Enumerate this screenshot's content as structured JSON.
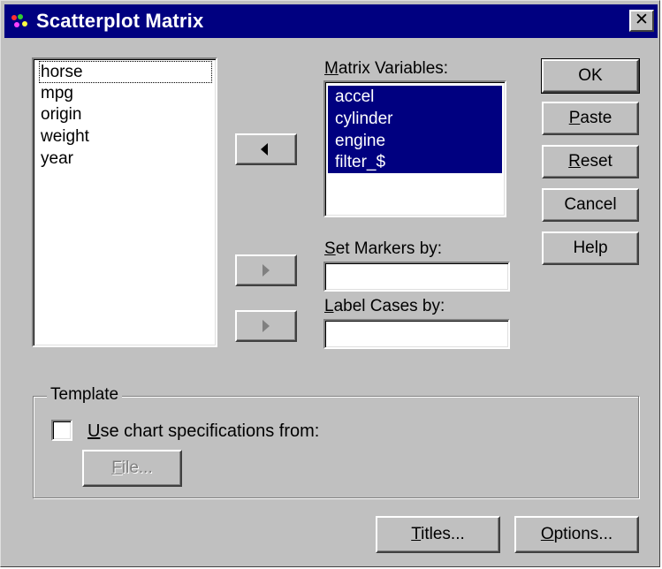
{
  "window": {
    "title": "Scatterplot Matrix",
    "close_glyph": "✕"
  },
  "source_list": {
    "items": [
      "horse",
      "mpg",
      "origin",
      "weight",
      "year"
    ]
  },
  "matrix_variables": {
    "label_mnemonic": "M",
    "label_rest": "atrix Variables:",
    "items": [
      "accel",
      "cylinder",
      "engine",
      "filter_$"
    ]
  },
  "set_markers": {
    "label_mnemonic": "S",
    "label_rest": "et Markers by:",
    "value": ""
  },
  "label_cases": {
    "label_mnemonic": "L",
    "label_rest": "abel Cases by:",
    "value": ""
  },
  "buttons": {
    "ok": "OK",
    "paste_mnemonic": "P",
    "paste_rest": "aste",
    "reset_mnemonic": "R",
    "reset_rest": "eset",
    "cancel": "Cancel",
    "help": "Help",
    "titles_mnemonic": "T",
    "titles_rest": "itles...",
    "options_mnemonic": "O",
    "options_rest": "ptions..."
  },
  "template": {
    "title": "Template",
    "checkbox_mnemonic": "U",
    "checkbox_rest": "se chart specifications from:",
    "checked": false,
    "file_mnemonic": "F",
    "file_rest": "ile..."
  },
  "colors": {
    "face": "#c0c0c0",
    "titlebar": "#000080",
    "selection": "#000080"
  }
}
